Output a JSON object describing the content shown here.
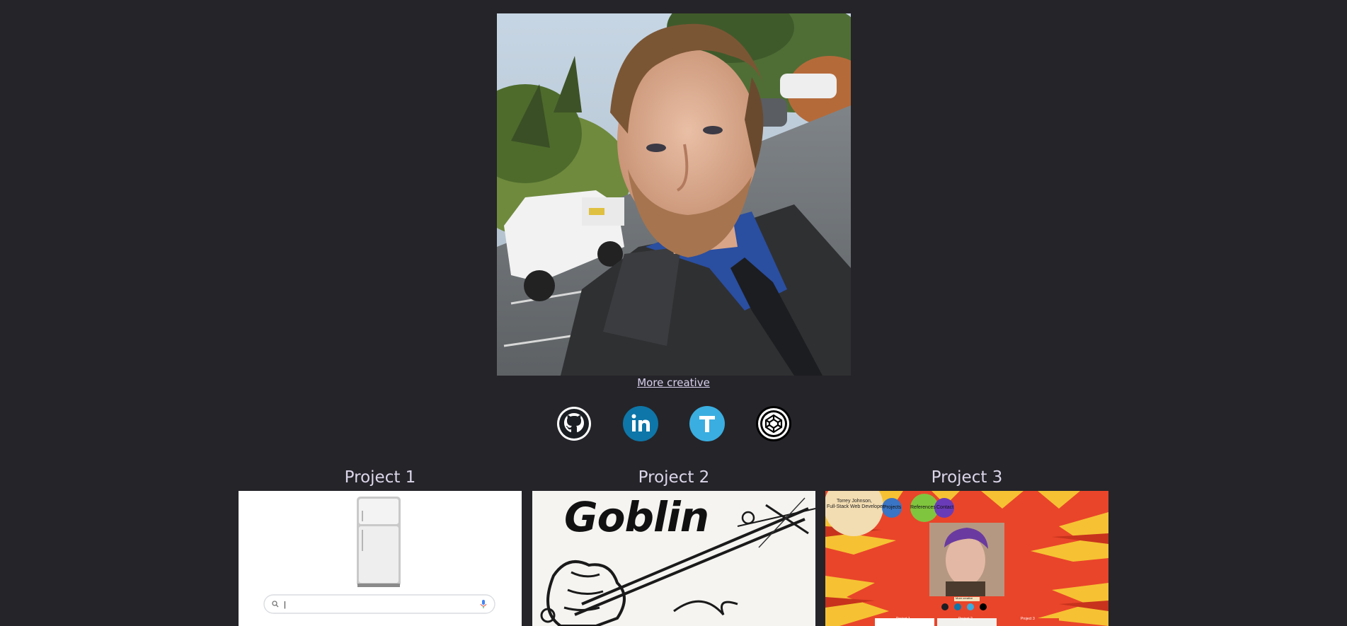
{
  "profile": {
    "photo_alt": "Profile photo",
    "more_link": "More creative"
  },
  "socials": [
    {
      "name": "github",
      "icon": "github-icon",
      "color": "#1b1f23"
    },
    {
      "name": "linkedin",
      "icon": "linkedin-icon",
      "color": "#0e76a8"
    },
    {
      "name": "twitter",
      "icon": "twitter-icon",
      "color": "#3aaee0"
    },
    {
      "name": "codepen",
      "icon": "codepen-icon",
      "color": "#000000"
    }
  ],
  "projects": [
    {
      "title": "Project 1",
      "thumb_search_value": "|"
    },
    {
      "title": "Project 2",
      "thumb_text": "Goblin"
    },
    {
      "title": "Project 3",
      "thumb_name": "Torrey Johnson,",
      "thumb_role": "Full-Stack Web Developer",
      "thumb_nav": [
        "Projects",
        "References",
        "Contact"
      ],
      "thumb_caption": "More creative",
      "thumb_projects": [
        "Project 1",
        "Project 2",
        "Project 3"
      ]
    }
  ],
  "colors": {
    "background": "#252429",
    "link": "#d8cfee",
    "heading": "#dcd6ea"
  }
}
